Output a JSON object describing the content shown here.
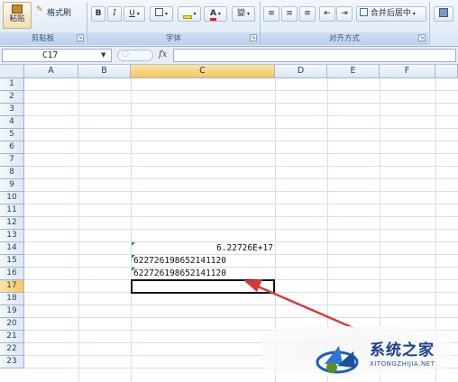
{
  "ribbon": {
    "clipboard": {
      "paste_label": "粘贴",
      "format_painter_label": "格式刷",
      "group_label": "剪贴板"
    },
    "font": {
      "bold": "B",
      "italic": "I",
      "underline": "U",
      "font_color_glyph": "A",
      "phonetic_glyph": "變",
      "group_label": "字体"
    },
    "alignment": {
      "merge_label": "合并后居中",
      "group_label": "对齐方式"
    }
  },
  "formula_bar": {
    "name_box_value": "C17",
    "fx_label": "fx",
    "formula_value": ""
  },
  "columns": [
    "A",
    "B",
    "C",
    "D",
    "E",
    "F"
  ],
  "rows": [
    "1",
    "2",
    "3",
    "4",
    "5",
    "6",
    "7",
    "8",
    "9",
    "10",
    "11",
    "12",
    "13",
    "14",
    "15",
    "16",
    "17",
    "18",
    "19",
    "20",
    "21",
    "22",
    "23"
  ],
  "cells": {
    "C14": "6.22726E+17",
    "C15": "622726198652141120",
    "C16": "622726198652141120"
  },
  "selected_cell": "C17",
  "watermark": {
    "title": "系统之家",
    "url": "XITONGZHIJIA.NET"
  },
  "colors": {
    "accent_red": "#d63a36",
    "selection_orange": "#f6c65e",
    "ribbon_blue": "#dbe7f5",
    "error_triangle": "#1f8a3a"
  }
}
